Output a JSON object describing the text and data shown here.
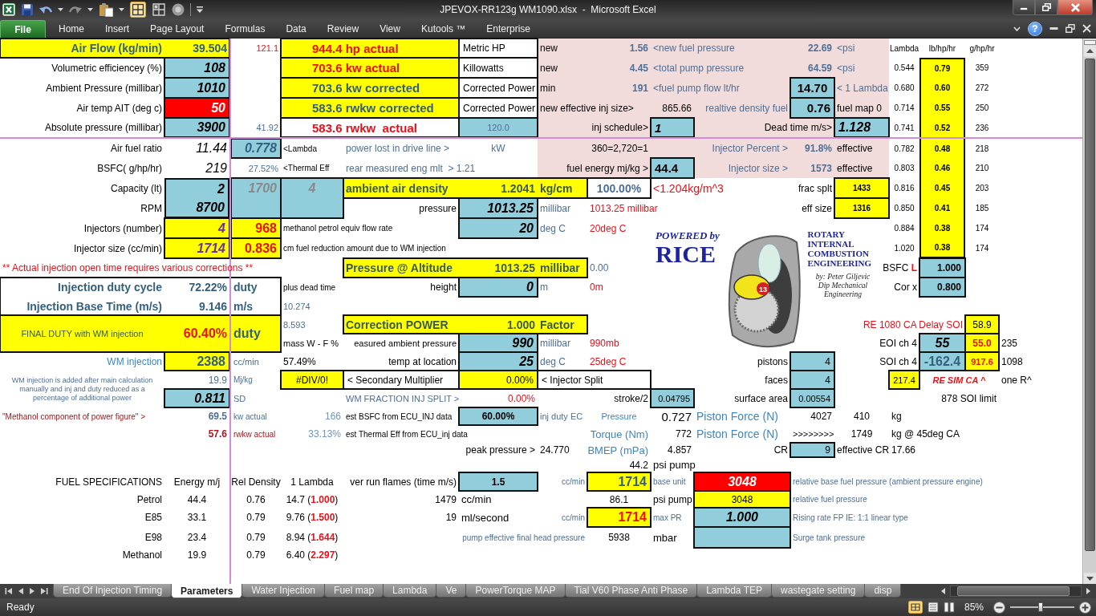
{
  "window": {
    "title": "JPEVOX-RR123g WM1090.xlsx  -  Microsoft Excel"
  },
  "ribbon": {
    "file_tab": "File",
    "tabs": [
      "Home",
      "Insert",
      "Page Layout",
      "Formulas",
      "Data",
      "Review",
      "View",
      "Kutools ™",
      "Enterprise"
    ],
    "help": "?"
  },
  "sheet": {
    "rows": [
      [
        "Air Flow (kg/min)",
        "39.504",
        "121.1",
        "944.4 hp actual",
        "",
        "Metric HP",
        "new",
        "1.56",
        "<new fuel pressure",
        "",
        "22.69",
        "<psi",
        "Lambda",
        "lb/hp/hr",
        "g/hp/hr"
      ],
      [
        "Volumetric efficiencey (%)",
        "108",
        "",
        "703.6 kw actual",
        "",
        "Killowatts",
        "new",
        "4.45",
        "<total pump pressure",
        "",
        "64.59",
        "<psi",
        "0.544",
        "0.79",
        "359"
      ],
      [
        "Ambient Pressure (millibar)",
        "1010",
        "",
        "703.6 kw corrected",
        "",
        "Corrected Power",
        "min",
        "191",
        "<fuel pump flow lt/hr",
        "",
        "14.70",
        "< 1 Lambda",
        "0.680",
        "0.60",
        "272"
      ],
      [
        "Air temp AIT (deg c)",
        "50",
        "",
        "583.6 rwkw corrected",
        "",
        "Corrected Power",
        "new effective inj size>",
        "",
        "865.66",
        "realtive density fuel",
        "0.76",
        "fuel map 0",
        "0.714",
        "0.55",
        "250"
      ],
      [
        "Absolute pressure (millibar)",
        "3900",
        "41.92",
        "583.6 rwkw  actual",
        "",
        "120.0",
        "",
        "inj schedule>",
        "1",
        "",
        "Dead time m/s>",
        "1.128",
        "0.741",
        "0.52",
        "236"
      ],
      [
        "Air fuel ratio",
        "11.44",
        "0.778",
        "<Lambda",
        "power lost in drive line >",
        "kW",
        "",
        "360=2,720=1",
        "",
        "Injector Percent >",
        "91.8%",
        "effective",
        "0.782",
        "0.48",
        "218"
      ],
      [
        "BSFC( g/hp/hr)",
        "219",
        "27.52%",
        "<Thermal Eff",
        "rear measured eng mlt  > 1.21",
        "",
        "",
        "fuel energy mj/kg >",
        "44.4",
        "Injector size >",
        "1573",
        "effective",
        "0.803",
        "0.46",
        "210"
      ],
      [
        "Capacity (lt)",
        "2",
        "1700",
        "4",
        "ambient air density",
        "1.2041",
        "kg/cm",
        "100.00%",
        "<1.204kg/m^3",
        "",
        "frac splt",
        "1433",
        "0.816",
        "0.45",
        "203"
      ],
      [
        "RPM",
        "8700",
        "",
        "",
        "pressure",
        "1013.25",
        "millibar",
        "1013.25 millibar",
        "",
        "",
        "eff size",
        "1316",
        "0.850",
        "0.41",
        "185"
      ],
      [
        "Injectors (number)",
        "4",
        "968",
        "methanol petrol equiv flow rate",
        "",
        "20",
        "deg C",
        "20deg C",
        "",
        "",
        "",
        "",
        "0.884",
        "0.38",
        "174"
      ],
      [
        "Injector size (cc/min)",
        "1714",
        "0.836",
        "cm fuel reduction amount due to WM injection",
        "",
        "",
        "",
        "",
        "",
        "",
        "",
        "",
        "1.020",
        "0.38",
        "174"
      ],
      [
        "** Actual injection open time requires various corrections **",
        "",
        "",
        "",
        "Pressure @ Altitude",
        "1013.25",
        "millibar",
        "0.00",
        "",
        "",
        "",
        "",
        "BSFC **L**",
        "1.000"
      ],
      [
        "Injection duty cycle",
        "72.22%",
        "duty",
        "plus dead time",
        "height",
        "0",
        "m",
        "0m",
        "",
        "",
        "",
        "",
        "Cor x",
        "0.800"
      ],
      [
        "Injection Base Time (m/s)",
        "9.146",
        "m/s",
        "10.274"
      ],
      [
        "FINAL DUTY with WM injection",
        "60.40%",
        "duty",
        "8.593",
        "Correction POWER",
        "1.000",
        "Factor",
        "",
        "",
        "",
        "",
        "",
        "",
        "RE 1080 CA Delay SOI",
        "58.9"
      ],
      [
        "",
        "",
        "",
        "mass W - F %",
        "easured ambient pressure",
        "990",
        "millibar",
        "990mb",
        "",
        "",
        "",
        "",
        "EOI ch 4",
        "55",
        "55.0",
        "235"
      ],
      [
        "WM injection",
        "2388",
        "cc/min",
        "57.49%",
        "temp at location",
        "25",
        "deg C",
        "25deg C",
        "",
        "pistons",
        "4",
        "",
        "SOI ch 4",
        "-162.4",
        "917.6",
        "1098"
      ],
      [
        "WM injection is added after main calculation manually and inj and duty reduced as a percentage of additional power",
        "19.9",
        "Mj/kg",
        "#DIV/0!",
        "< Secondary Multiplier",
        "0.00%",
        "< Injector Split",
        "",
        "",
        "faces",
        "4",
        "",
        "217.4",
        "RE SIM CA ^",
        "",
        "one R^"
      ],
      [
        "",
        "0.811",
        "SD",
        "",
        "WM FRACTION INJ SPLIT >",
        "0.00%",
        "",
        "stroke/2",
        "0.04795",
        "surface area",
        "0.00554",
        "",
        "",
        "",
        "878 SOI limit"
      ],
      [
        "\"Methanol component of power figure\" >",
        "69.5",
        "kw actual",
        "166",
        "est BSFC from ECU_INJ data",
        "60.00%",
        "inj duty EC",
        "Pressure",
        "0.727",
        "Piston Force (N)",
        "4027",
        "410",
        "kg"
      ],
      [
        "",
        "57.6",
        "rwkw actual",
        "33.13%",
        "est Thermal Eff from ECU_inj data",
        "",
        "",
        "Torque (Nm)",
        "772",
        "Piston Force (N)",
        ">>>>>>>>",
        "1749",
        "kg @ 45deg CA"
      ],
      [
        "",
        "",
        "",
        "",
        "",
        "peak pressure >",
        "24.770",
        "BMEP (mPa)",
        "4.857",
        "CR",
        "9",
        "effective CR",
        "17.66"
      ],
      [
        "",
        "",
        "",
        "",
        "",
        "",
        "",
        "44.2",
        "psi pump"
      ],
      [
        "FUEL SPECIFICATIONS",
        "Energy m/j",
        "Rel Density",
        "1 Lambda",
        "ver run flames (time m/s)",
        "1.5",
        "cc/min",
        "1714",
        "base unit",
        "3048",
        "relative base fuel pressure (ambient pressure engine)"
      ],
      [
        "Petrol",
        "44.4",
        "0.76",
        "14.7 (**1.000**)",
        "1479",
        "cc/min",
        "",
        "86.1",
        "psi pump",
        "3048",
        "relative fuel pressure"
      ],
      [
        "E85",
        "33.1",
        "0.79",
        "9.76 (**1.500**)",
        "19",
        "ml/second",
        "cc/min",
        "1714",
        "max PR",
        "1.000",
        "Rising rate FP IE: 1:1 linear type"
      ],
      [
        "E98",
        "23.4",
        "0.79",
        "8.94 (**1.644**)",
        "",
        "",
        "pump effective final head pressure",
        "5938",
        "mbar",
        "",
        "Surge tank pressure"
      ],
      [
        "Methanol",
        "19.9",
        "0.79",
        "6.40 (**2.297**)"
      ]
    ]
  },
  "logo": {
    "tagline": "POWERED by",
    "brand": "RICE",
    "heading": "ROTARY INTERNAL COMBUSTION ENGINEERING",
    "credits": "by: Peter Giljevic Dip Mechanical Engineering",
    "mascot_number": "13"
  },
  "sheet_tabs": [
    {
      "label": "End Of Injection Timing",
      "selected": false
    },
    {
      "label": "Parameters",
      "selected": true
    },
    {
      "label": "Water Injection",
      "selected": false
    },
    {
      "label": "Fuel map",
      "selected": false
    },
    {
      "label": "Lambda",
      "selected": false
    },
    {
      "label": "Ve",
      "selected": false
    },
    {
      "label": "PowerTorque MAP",
      "selected": false
    },
    {
      "label": "Tial V60 Phase Anti Phase",
      "selected": false
    },
    {
      "label": "Lambda TEP",
      "selected": false
    },
    {
      "label": "wastegate setting",
      "selected": false
    },
    {
      "label": "disp",
      "selected": false
    }
  ],
  "status_bar": {
    "status": "Ready",
    "zoom": "85%",
    "zoom_slider": {
      "level": 0.47
    }
  }
}
